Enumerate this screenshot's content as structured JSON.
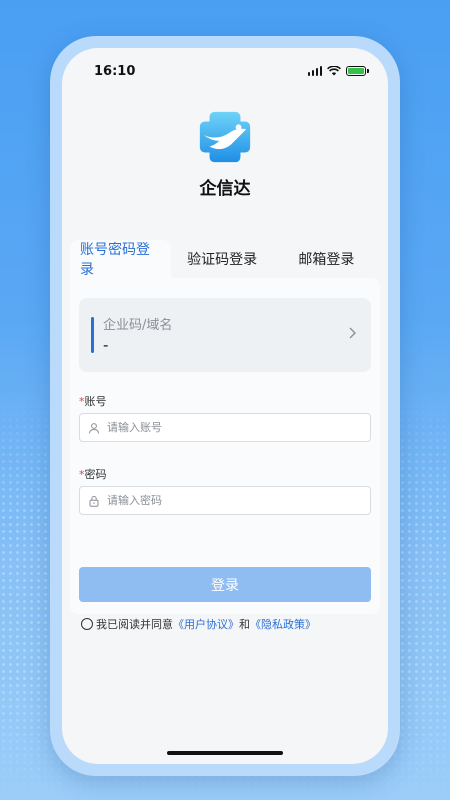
{
  "status_bar": {
    "time": "16:10"
  },
  "app": {
    "name": "企信达"
  },
  "tabs": [
    {
      "label": "账号密码登录",
      "active": true
    },
    {
      "label": "验证码登录",
      "active": false
    },
    {
      "label": "邮箱登录",
      "active": false
    }
  ],
  "company": {
    "label": "企业码/域名",
    "value": "-"
  },
  "account": {
    "required_mark": "*",
    "label": "账号",
    "placeholder": "请输入账号",
    "icon": "user-icon"
  },
  "password": {
    "required_mark": "*",
    "label": "密码",
    "placeholder": "请输入密码",
    "icon": "lock-icon"
  },
  "login_button": {
    "label": "登录"
  },
  "agreement": {
    "prefix": "我已阅读并同意",
    "user_agreement": "《用户协议》",
    "conjunction": "和",
    "privacy_policy": "《隐私政策》"
  },
  "colors": {
    "accent": "#2a6fd6",
    "button": "#8fbdf2",
    "required": "#e04040"
  }
}
